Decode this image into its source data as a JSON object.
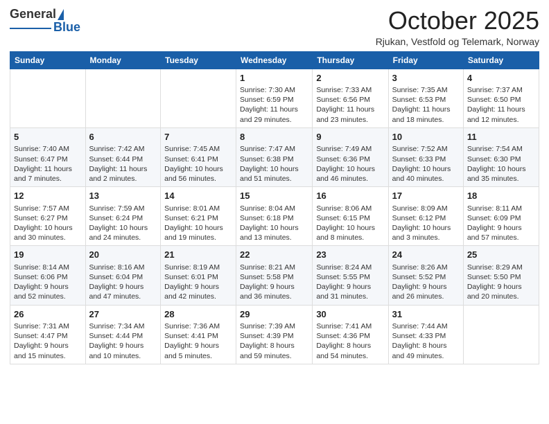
{
  "header": {
    "logo_general": "General",
    "logo_blue": "Blue",
    "month_title": "October 2025",
    "subtitle": "Rjukan, Vestfold og Telemark, Norway"
  },
  "days_of_week": [
    "Sunday",
    "Monday",
    "Tuesday",
    "Wednesday",
    "Thursday",
    "Friday",
    "Saturday"
  ],
  "weeks": [
    [
      {
        "day": "",
        "info": ""
      },
      {
        "day": "",
        "info": ""
      },
      {
        "day": "",
        "info": ""
      },
      {
        "day": "1",
        "info": "Sunrise: 7:30 AM\nSunset: 6:59 PM\nDaylight: 11 hours\nand 29 minutes."
      },
      {
        "day": "2",
        "info": "Sunrise: 7:33 AM\nSunset: 6:56 PM\nDaylight: 11 hours\nand 23 minutes."
      },
      {
        "day": "3",
        "info": "Sunrise: 7:35 AM\nSunset: 6:53 PM\nDaylight: 11 hours\nand 18 minutes."
      },
      {
        "day": "4",
        "info": "Sunrise: 7:37 AM\nSunset: 6:50 PM\nDaylight: 11 hours\nand 12 minutes."
      }
    ],
    [
      {
        "day": "5",
        "info": "Sunrise: 7:40 AM\nSunset: 6:47 PM\nDaylight: 11 hours\nand 7 minutes."
      },
      {
        "day": "6",
        "info": "Sunrise: 7:42 AM\nSunset: 6:44 PM\nDaylight: 11 hours\nand 2 minutes."
      },
      {
        "day": "7",
        "info": "Sunrise: 7:45 AM\nSunset: 6:41 PM\nDaylight: 10 hours\nand 56 minutes."
      },
      {
        "day": "8",
        "info": "Sunrise: 7:47 AM\nSunset: 6:38 PM\nDaylight: 10 hours\nand 51 minutes."
      },
      {
        "day": "9",
        "info": "Sunrise: 7:49 AM\nSunset: 6:36 PM\nDaylight: 10 hours\nand 46 minutes."
      },
      {
        "day": "10",
        "info": "Sunrise: 7:52 AM\nSunset: 6:33 PM\nDaylight: 10 hours\nand 40 minutes."
      },
      {
        "day": "11",
        "info": "Sunrise: 7:54 AM\nSunset: 6:30 PM\nDaylight: 10 hours\nand 35 minutes."
      }
    ],
    [
      {
        "day": "12",
        "info": "Sunrise: 7:57 AM\nSunset: 6:27 PM\nDaylight: 10 hours\nand 30 minutes."
      },
      {
        "day": "13",
        "info": "Sunrise: 7:59 AM\nSunset: 6:24 PM\nDaylight: 10 hours\nand 24 minutes."
      },
      {
        "day": "14",
        "info": "Sunrise: 8:01 AM\nSunset: 6:21 PM\nDaylight: 10 hours\nand 19 minutes."
      },
      {
        "day": "15",
        "info": "Sunrise: 8:04 AM\nSunset: 6:18 PM\nDaylight: 10 hours\nand 13 minutes."
      },
      {
        "day": "16",
        "info": "Sunrise: 8:06 AM\nSunset: 6:15 PM\nDaylight: 10 hours\nand 8 minutes."
      },
      {
        "day": "17",
        "info": "Sunrise: 8:09 AM\nSunset: 6:12 PM\nDaylight: 10 hours\nand 3 minutes."
      },
      {
        "day": "18",
        "info": "Sunrise: 8:11 AM\nSunset: 6:09 PM\nDaylight: 9 hours\nand 57 minutes."
      }
    ],
    [
      {
        "day": "19",
        "info": "Sunrise: 8:14 AM\nSunset: 6:06 PM\nDaylight: 9 hours\nand 52 minutes."
      },
      {
        "day": "20",
        "info": "Sunrise: 8:16 AM\nSunset: 6:04 PM\nDaylight: 9 hours\nand 47 minutes."
      },
      {
        "day": "21",
        "info": "Sunrise: 8:19 AM\nSunset: 6:01 PM\nDaylight: 9 hours\nand 42 minutes."
      },
      {
        "day": "22",
        "info": "Sunrise: 8:21 AM\nSunset: 5:58 PM\nDaylight: 9 hours\nand 36 minutes."
      },
      {
        "day": "23",
        "info": "Sunrise: 8:24 AM\nSunset: 5:55 PM\nDaylight: 9 hours\nand 31 minutes."
      },
      {
        "day": "24",
        "info": "Sunrise: 8:26 AM\nSunset: 5:52 PM\nDaylight: 9 hours\nand 26 minutes."
      },
      {
        "day": "25",
        "info": "Sunrise: 8:29 AM\nSunset: 5:50 PM\nDaylight: 9 hours\nand 20 minutes."
      }
    ],
    [
      {
        "day": "26",
        "info": "Sunrise: 7:31 AM\nSunset: 4:47 PM\nDaylight: 9 hours\nand 15 minutes."
      },
      {
        "day": "27",
        "info": "Sunrise: 7:34 AM\nSunset: 4:44 PM\nDaylight: 9 hours\nand 10 minutes."
      },
      {
        "day": "28",
        "info": "Sunrise: 7:36 AM\nSunset: 4:41 PM\nDaylight: 9 hours\nand 5 minutes."
      },
      {
        "day": "29",
        "info": "Sunrise: 7:39 AM\nSunset: 4:39 PM\nDaylight: 8 hours\nand 59 minutes."
      },
      {
        "day": "30",
        "info": "Sunrise: 7:41 AM\nSunset: 4:36 PM\nDaylight: 8 hours\nand 54 minutes."
      },
      {
        "day": "31",
        "info": "Sunrise: 7:44 AM\nSunset: 4:33 PM\nDaylight: 8 hours\nand 49 minutes."
      },
      {
        "day": "",
        "info": ""
      }
    ]
  ]
}
